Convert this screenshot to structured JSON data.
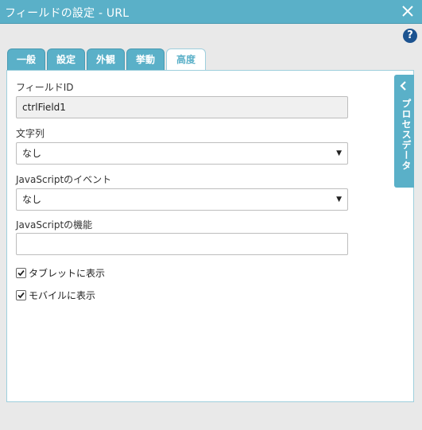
{
  "window": {
    "title": "フィールドの設定 - URL",
    "close_icon": "close-icon"
  },
  "help": {
    "glyph": "?"
  },
  "tabs": [
    {
      "label": "一般"
    },
    {
      "label": "設定"
    },
    {
      "label": "外観"
    },
    {
      "label": "挙動"
    },
    {
      "label": "高度",
      "active": true
    }
  ],
  "form": {
    "field_id": {
      "label": "フィールドID",
      "value": "ctrlField1"
    },
    "string": {
      "label": "文字列",
      "value": "なし"
    },
    "js_event": {
      "label": "JavaScriptのイベント",
      "value": "なし"
    },
    "js_function": {
      "label": "JavaScriptの機能",
      "value": ""
    },
    "tablet": {
      "label": "タブレットに表示",
      "checked": true
    },
    "mobile": {
      "label": "モバイルに表示",
      "checked": true
    }
  },
  "side_panel": {
    "label": "プロセスデータ"
  },
  "colors": {
    "accent": "#5ab0c8",
    "help": "#1c5390"
  }
}
